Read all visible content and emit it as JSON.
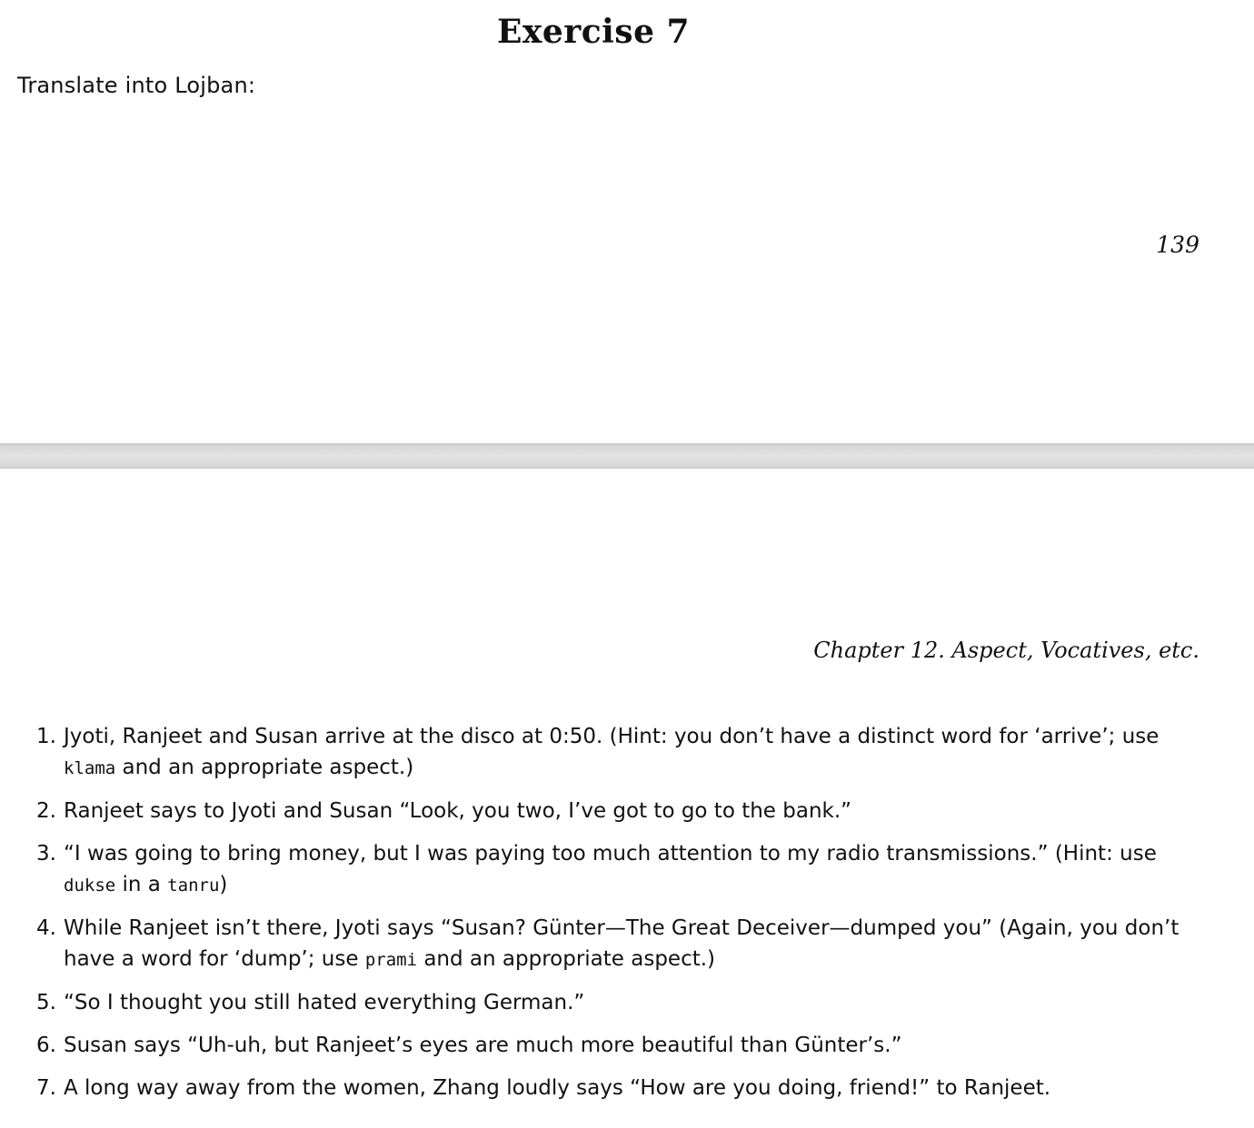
{
  "top_page": {
    "title": "Exercise 7",
    "instruction": "Translate into Lojban:",
    "page_number": "139"
  },
  "bottom_page": {
    "running_head": "Chapter 12. Aspect, Vocatives, etc.",
    "items": [
      {
        "number": "1.",
        "parts": [
          "Jyoti, Ranjeet and Susan arrive at the disco at 0:50. (Hint: you don’t have a distinct word for ‘arrive’; use ",
          "klama",
          " and an appropriate aspect.)"
        ]
      },
      {
        "number": "2.",
        "parts": [
          "Ranjeet says to Jyoti and Susan “Look, you two, I’ve got to go to the bank.”"
        ]
      },
      {
        "number": "3.",
        "parts": [
          "“I was going to bring money, but I was paying too much attention to my radio transmissions.” (Hint: use ",
          "dukse",
          " in a ",
          "tanru",
          ")"
        ]
      },
      {
        "number": "4.",
        "parts": [
          "While Ranjeet isn’t there, Jyoti says “Susan? Günter—The Great Deceiver—dumped you” (Again, you don’t have a word for ‘dump’; use ",
          "prami",
          " and an appropriate aspect.)"
        ]
      },
      {
        "number": "5.",
        "parts": [
          "“So I thought you still hated everything German.”"
        ]
      },
      {
        "number": "6.",
        "parts": [
          "Susan says “Uh-uh, but Ranjeet’s eyes are much more beautiful than Günter’s.”"
        ]
      },
      {
        "number": "7.",
        "parts": [
          "A long way away from the women, Zhang loudly says “How are you doing, friend!” to Ranjeet."
        ]
      }
    ]
  }
}
